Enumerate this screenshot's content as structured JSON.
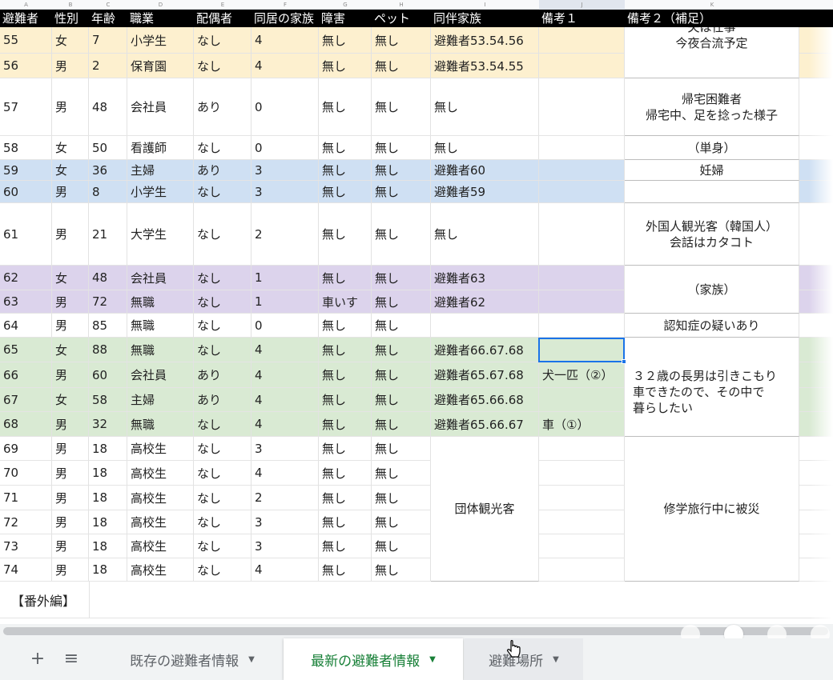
{
  "column_letters": [
    "A",
    "B",
    "C",
    "D",
    "E",
    "F",
    "G",
    "H",
    "I",
    "J",
    "K"
  ],
  "headers": [
    "避難者",
    "性別",
    "年齢",
    "職業",
    "配偶者",
    "同居の家族",
    "障害",
    "ペット",
    "同伴家族",
    "備考１",
    "備考２（補足）"
  ],
  "rows": [
    {
      "id": "55",
      "sex": "女",
      "age": "7",
      "job": "小学生",
      "spouse": "なし",
      "family": "4",
      "disability": "無し",
      "pet": "無し",
      "companion": "避難者53.54.56",
      "note1": ""
    },
    {
      "id": "56",
      "sex": "男",
      "age": "2",
      "job": "保育園",
      "spouse": "なし",
      "family": "4",
      "disability": "無し",
      "pet": "無し",
      "companion": "避難者53.54.55",
      "note1": ""
    },
    {
      "id": "57",
      "sex": "男",
      "age": "48",
      "job": "会社員",
      "spouse": "あり",
      "family": "0",
      "disability": "無し",
      "pet": "無し",
      "companion": "無し",
      "note1": ""
    },
    {
      "id": "58",
      "sex": "女",
      "age": "50",
      "job": "看護師",
      "spouse": "なし",
      "family": "0",
      "disability": "無し",
      "pet": "無し",
      "companion": "無し",
      "note1": ""
    },
    {
      "id": "59",
      "sex": "女",
      "age": "36",
      "job": "主婦",
      "spouse": "あり",
      "family": "3",
      "disability": "無し",
      "pet": "無し",
      "companion": "避難者60",
      "note1": ""
    },
    {
      "id": "60",
      "sex": "男",
      "age": "8",
      "job": "小学生",
      "spouse": "なし",
      "family": "3",
      "disability": "無し",
      "pet": "無し",
      "companion": "避難者59",
      "note1": ""
    },
    {
      "id": "61",
      "sex": "男",
      "age": "21",
      "job": "大学生",
      "spouse": "なし",
      "family": "2",
      "disability": "無し",
      "pet": "無し",
      "companion": "無し",
      "note1": ""
    },
    {
      "id": "62",
      "sex": "女",
      "age": "48",
      "job": "会社員",
      "spouse": "なし",
      "family": "1",
      "disability": "無し",
      "pet": "無し",
      "companion": "避難者63",
      "note1": ""
    },
    {
      "id": "63",
      "sex": "男",
      "age": "72",
      "job": "無職",
      "spouse": "なし",
      "family": "1",
      "disability": "車いす",
      "pet": "無し",
      "companion": "避難者62",
      "note1": ""
    },
    {
      "id": "64",
      "sex": "男",
      "age": "85",
      "job": "無職",
      "spouse": "なし",
      "family": "0",
      "disability": "無し",
      "pet": "無し",
      "companion": "",
      "note1": ""
    },
    {
      "id": "65",
      "sex": "女",
      "age": "88",
      "job": "無職",
      "spouse": "なし",
      "family": "4",
      "disability": "無し",
      "pet": "無し",
      "companion": "避難者66.67.68",
      "note1": ""
    },
    {
      "id": "66",
      "sex": "男",
      "age": "60",
      "job": "会社員",
      "spouse": "あり",
      "family": "4",
      "disability": "無し",
      "pet": "無し",
      "companion": "避難者65.67.68",
      "note1": "犬一匹（②）"
    },
    {
      "id": "67",
      "sex": "女",
      "age": "58",
      "job": "主婦",
      "spouse": "あり",
      "family": "4",
      "disability": "無し",
      "pet": "無し",
      "companion": "避難者65.66.68",
      "note1": ""
    },
    {
      "id": "68",
      "sex": "男",
      "age": "32",
      "job": "無職",
      "spouse": "なし",
      "family": "4",
      "disability": "無し",
      "pet": "無し",
      "companion": "避難者65.66.67",
      "note1": "車（①）"
    },
    {
      "id": "69",
      "sex": "男",
      "age": "18",
      "job": "高校生",
      "spouse": "なし",
      "family": "3",
      "disability": "無し",
      "pet": "無し",
      "companion": "",
      "note1": ""
    },
    {
      "id": "70",
      "sex": "男",
      "age": "18",
      "job": "高校生",
      "spouse": "なし",
      "family": "4",
      "disability": "無し",
      "pet": "無し",
      "companion": "",
      "note1": ""
    },
    {
      "id": "71",
      "sex": "男",
      "age": "18",
      "job": "高校生",
      "spouse": "なし",
      "family": "2",
      "disability": "無し",
      "pet": "無し",
      "companion": "",
      "note1": ""
    },
    {
      "id": "72",
      "sex": "男",
      "age": "18",
      "job": "高校生",
      "spouse": "なし",
      "family": "3",
      "disability": "無し",
      "pet": "無し",
      "companion": "",
      "note1": ""
    },
    {
      "id": "73",
      "sex": "男",
      "age": "18",
      "job": "高校生",
      "spouse": "なし",
      "family": "3",
      "disability": "無し",
      "pet": "無し",
      "companion": "",
      "note1": ""
    },
    {
      "id": "74",
      "sex": "男",
      "age": "18",
      "job": "高校生",
      "spouse": "なし",
      "family": "4",
      "disability": "無し",
      "pet": "無し",
      "companion": "",
      "note1": ""
    }
  ],
  "remarks": {
    "r55_56": "夫は仕事\n今夜合流予定",
    "r57": "帰宅困難者\n帰宅中、足を捻った様子",
    "r58": "（単身）",
    "r59": "妊婦",
    "r61": "外国人観光客（韓国人）\n会話はカタコト",
    "r62_63": "（家族）",
    "r64": "認知症の疑いあり",
    "r65_68": "３２歳の長男は引きこもり\n車できたので、その中で\n暮らしたい",
    "r69_74": "修学旅行中に被災"
  },
  "group_companion": "団体観光客",
  "extra_section": "【番外編】",
  "sheet_tabs": [
    "既存の避難者情報",
    "最新の避難者情報",
    "避難場所"
  ],
  "active_tab": "最新の避難者情報",
  "icons": {
    "add": "plus-icon",
    "all_sheets": "menu-icon",
    "tab_menu": "caret-down-icon"
  },
  "colors": {
    "header_bg": "#000000",
    "yellow": "#fdf0cf",
    "blue": "#cfe0f3",
    "purple": "#dcd3ec",
    "green": "#d9ead3",
    "active_tab_text": "#188038"
  }
}
